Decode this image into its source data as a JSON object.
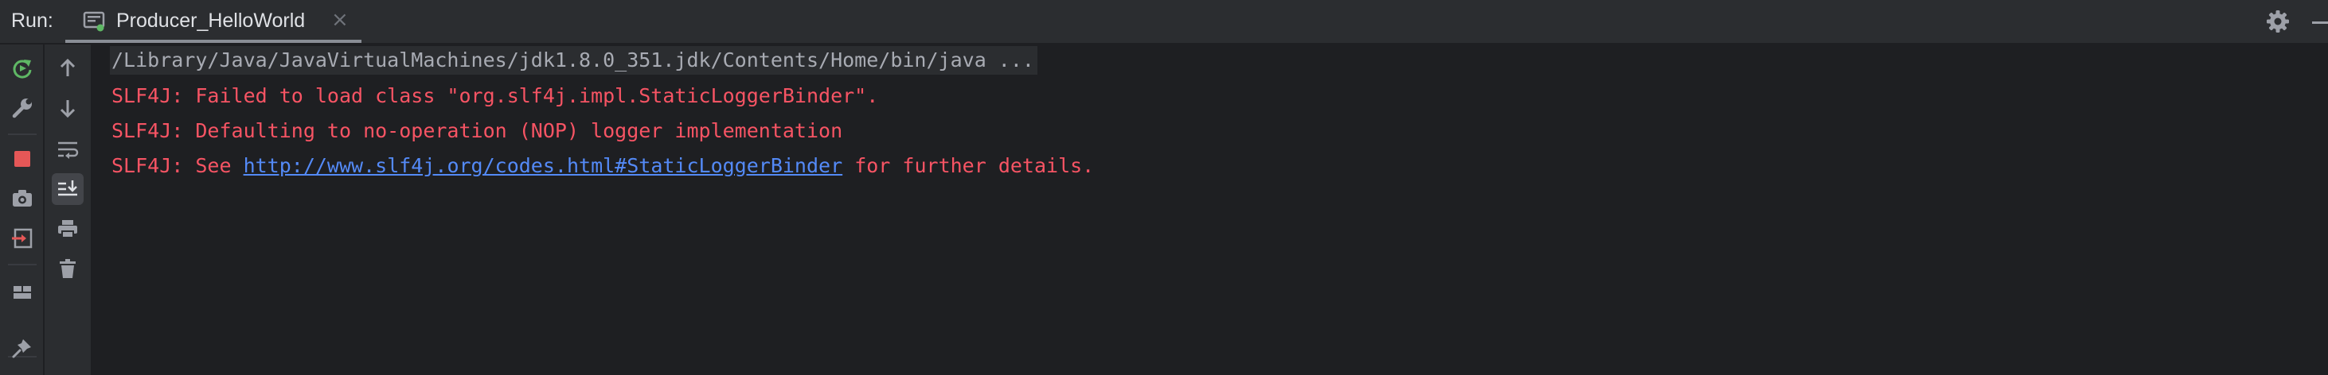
{
  "header": {
    "run_label": "Run:",
    "tab_title": "Producer_HelloWorld",
    "tab_close": "×"
  },
  "console": {
    "command": "/Library/Java/JavaVirtualMachines/jdk1.8.0_351.jdk/Contents/Home/bin/java ...",
    "line1": "SLF4J: Failed to load class \"org.slf4j.impl.StaticLoggerBinder\".",
    "line2": "SLF4J: Defaulting to no-operation (NOP) logger implementation",
    "line3_prefix": "SLF4J: See ",
    "line3_link": "http://www.slf4j.org/codes.html#StaticLoggerBinder",
    "line3_suffix": " for further details."
  },
  "colors": {
    "error_text": "#f75464",
    "link": "#548af7",
    "command_text": "#a8abb3",
    "rerun_green": "#5fb865",
    "stop_red": "#e55757",
    "console_bg": "#1e1f22",
    "panel_bg": "#2b2d30"
  },
  "icons": {
    "tab": "run-config-icon",
    "settings": "gear-icon",
    "hide": "minimize-icon",
    "toolbar_left": [
      "rerun-icon",
      "wrench-icon",
      "stop-icon",
      "camera-icon",
      "exit-icon",
      "layout-icon",
      "pin-icon"
    ],
    "toolbar_right": [
      "arrow-up-icon",
      "arrow-down-icon",
      "soft-wrap-icon",
      "scroll-to-end-icon",
      "print-icon",
      "trash-icon"
    ]
  }
}
